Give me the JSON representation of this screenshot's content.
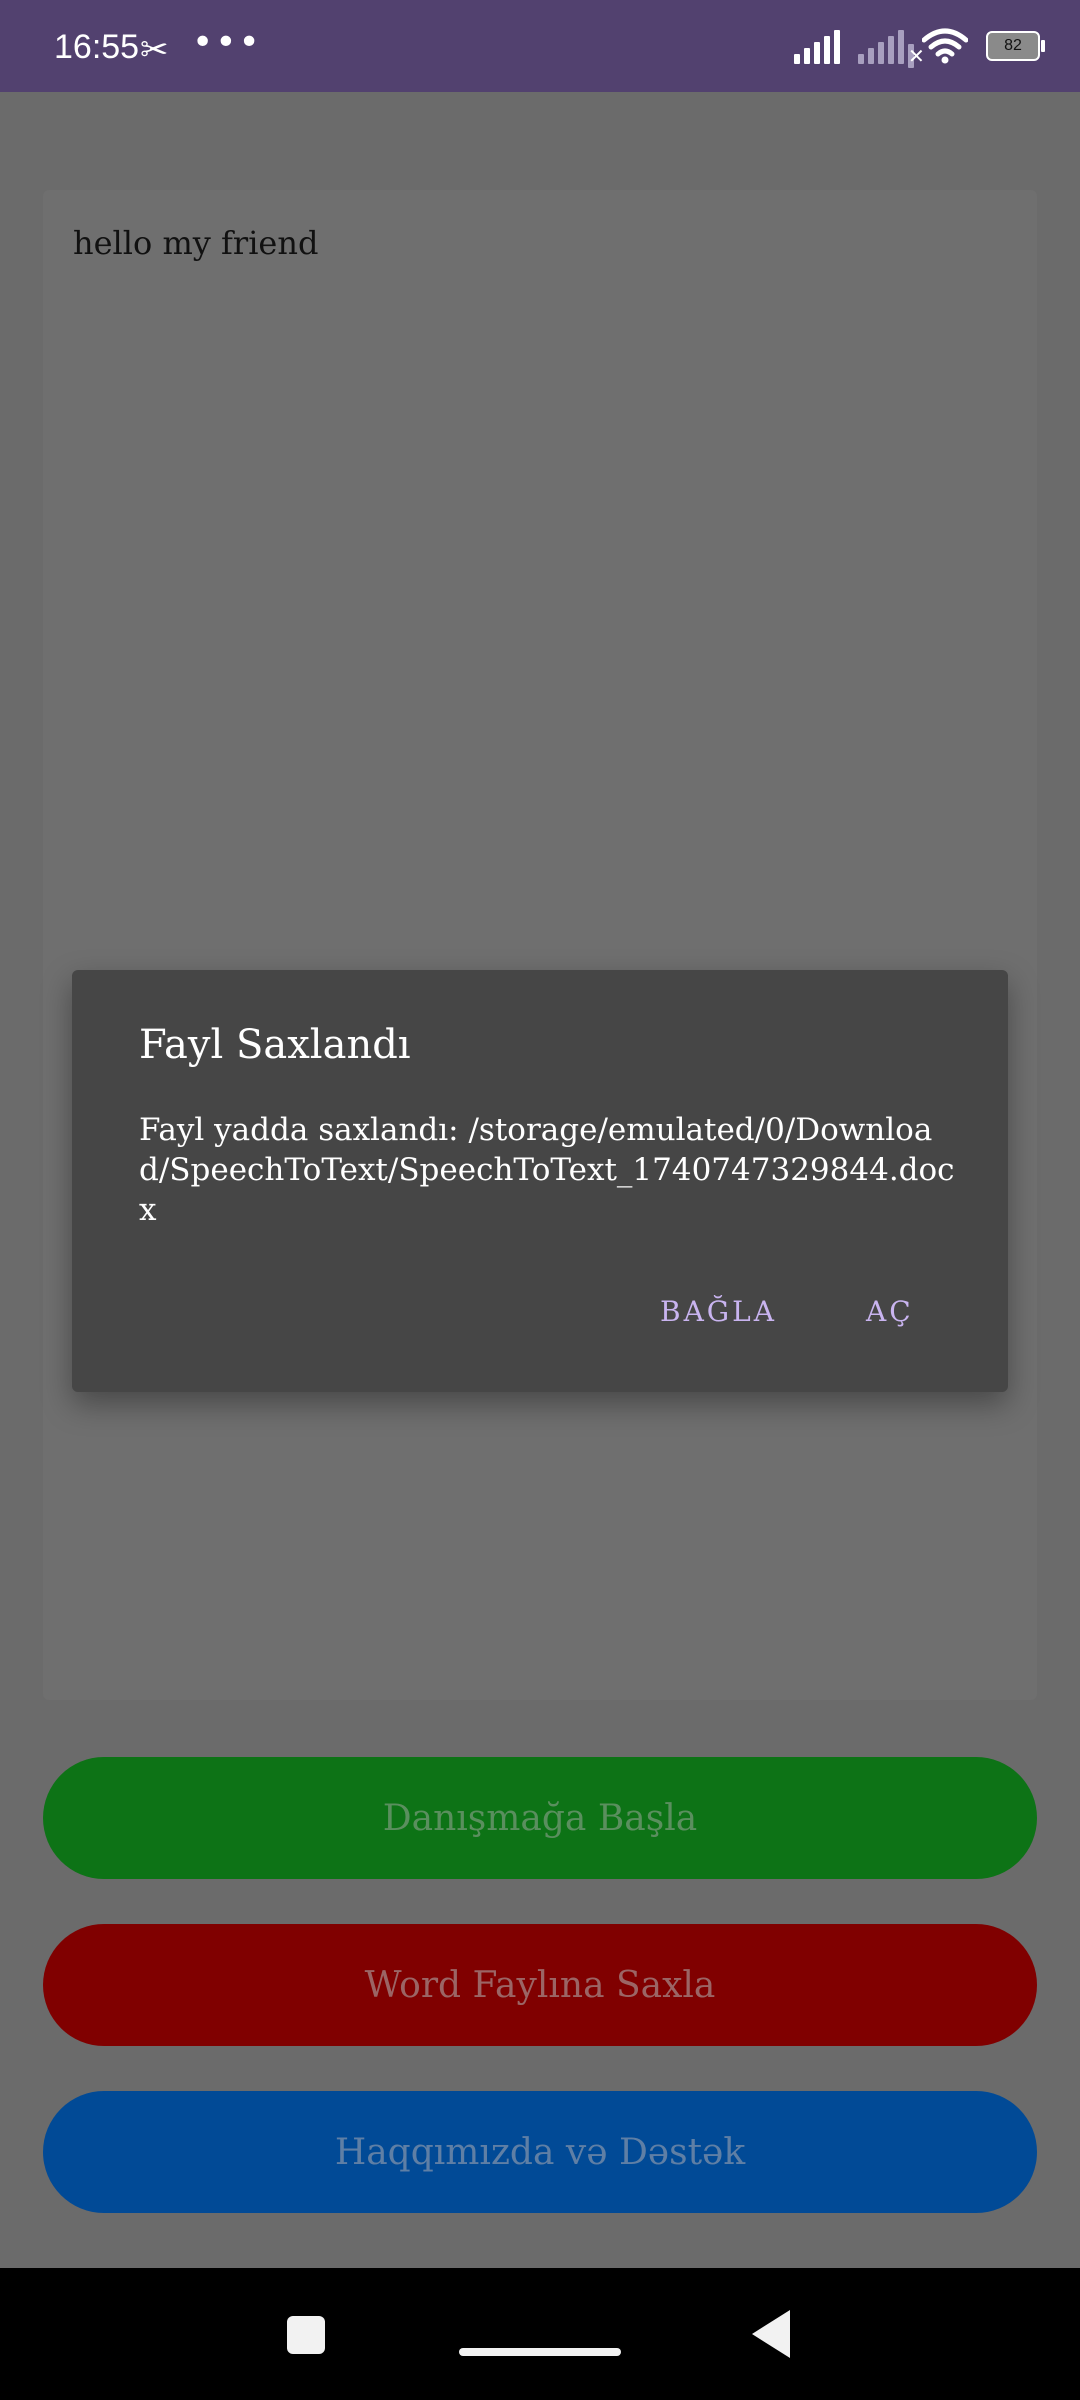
{
  "status_bar": {
    "time": "16:55",
    "app_icon": "capcut-icon",
    "more_icon": "more-dots-icon",
    "battery_level": "82",
    "colors": {
      "background": "#52416f"
    }
  },
  "editor": {
    "text": "hello my friend"
  },
  "buttons": {
    "start_label": "Danışmağa Başla",
    "save_label": "Word Faylına Saxla",
    "about_label": "Haqqımızda və Dəstək",
    "colors": {
      "start": "#0d7316",
      "save": "#800000",
      "about": "#014a96"
    }
  },
  "dialog": {
    "title": "Fayl Saxlandı",
    "message": "Fayl yadda saxlandı: /storage/emulated/0/Download/SpeechToText/SpeechToText_1740747329844.docx",
    "close_label": "BAĞLA",
    "open_label": "AÇ",
    "accent": "#c9b4f0"
  },
  "nav_bar": {
    "recents_icon": "recents-square-icon",
    "home_icon": "home-pill-icon",
    "back_icon": "back-triangle-icon"
  }
}
